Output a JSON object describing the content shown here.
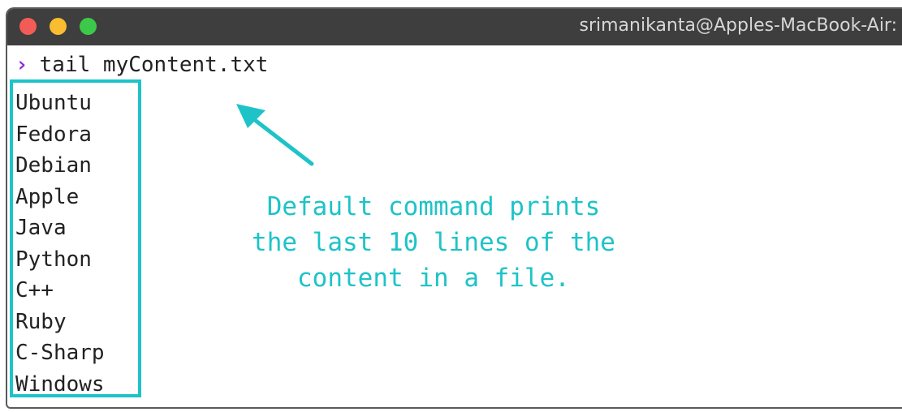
{
  "window": {
    "title": "srimanikanta@Apples-MacBook-Air:"
  },
  "terminal": {
    "prompt_symbol": "›",
    "command": "tail myContent.txt",
    "output_lines": [
      "Ubuntu",
      "Fedora",
      "Debian",
      "Apple",
      "Java",
      "Python",
      "C++",
      "Ruby",
      "C-Sharp",
      "Windows"
    ]
  },
  "annotation": {
    "lines": [
      "Default command prints",
      "the last 10 lines of the",
      "content in a file."
    ],
    "color": "#1ec3c8"
  },
  "colors": {
    "titlebar": "#3e3e3e",
    "close": "#f35c56",
    "minimize": "#f9bd2f",
    "zoom": "#3cc94a",
    "prompt": "#8a2be2"
  }
}
